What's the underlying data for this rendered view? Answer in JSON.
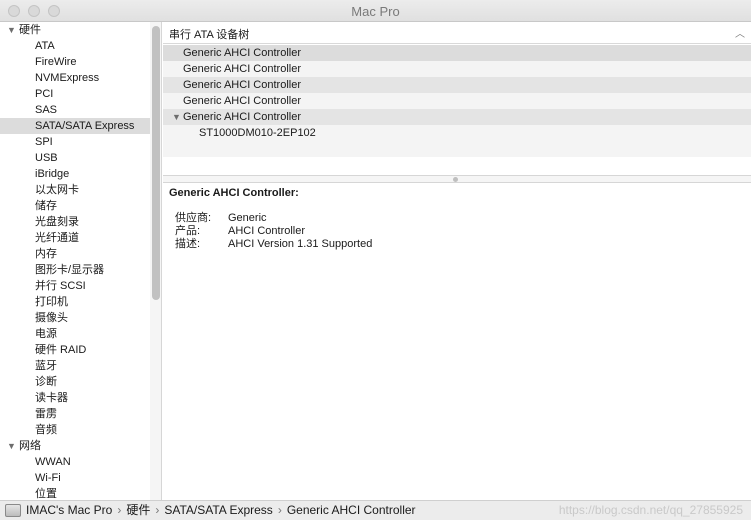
{
  "window": {
    "title": "Mac Pro"
  },
  "sidebar": {
    "groups": [
      {
        "label": "硬件",
        "items": [
          "ATA",
          "FireWire",
          "NVMExpress",
          "PCI",
          "SAS",
          "SATA/SATA Express",
          "SPI",
          "USB",
          "iBridge",
          "以太网卡",
          "储存",
          "光盘刻录",
          "光纤通道",
          "内存",
          "图形卡/显示器",
          "并行 SCSI",
          "打印机",
          "摄像头",
          "电源",
          "硬件 RAID",
          "蓝牙",
          "诊断",
          "读卡器",
          "雷雳",
          "音频"
        ]
      },
      {
        "label": "网络",
        "items": [
          "WWAN",
          "Wi-Fi",
          "位置"
        ]
      }
    ],
    "selected": "SATA/SATA Express"
  },
  "main": {
    "header": "串行 ATA 设备树",
    "rows": [
      {
        "label": "Generic AHCI Controller",
        "indent": 0,
        "expanded": false
      },
      {
        "label": "Generic AHCI Controller",
        "indent": 0,
        "expanded": false
      },
      {
        "label": "Generic AHCI Controller",
        "indent": 0,
        "expanded": false
      },
      {
        "label": "Generic AHCI Controller",
        "indent": 0,
        "expanded": false
      },
      {
        "label": "Generic AHCI Controller",
        "indent": 0,
        "expanded": true
      },
      {
        "label": "ST1000DM010-2EP102",
        "indent": 1,
        "expanded": false
      }
    ],
    "detail": {
      "title": "Generic AHCI Controller:",
      "fields": [
        {
          "key": "供应商:",
          "value": "Generic"
        },
        {
          "key": "产品:",
          "value": "AHCI Controller"
        },
        {
          "key": "描述:",
          "value": "AHCI Version 1.31 Supported"
        }
      ]
    }
  },
  "statusbar": {
    "path": [
      "IMAC's Mac Pro",
      "硬件",
      "SATA/SATA Express",
      "Generic AHCI Controller"
    ],
    "watermark": "https://blog.csdn.net/qq_27855925"
  },
  "icons": {
    "group_expanded": "▼",
    "header_sort": "chevron-up"
  }
}
